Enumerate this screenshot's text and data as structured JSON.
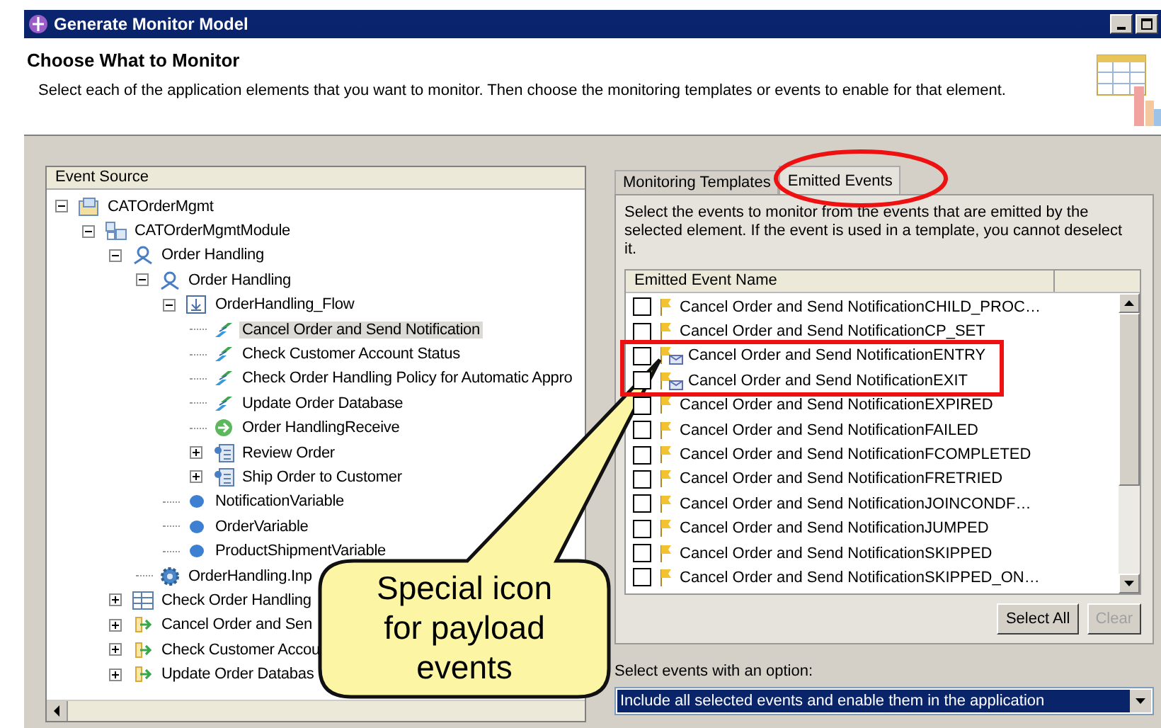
{
  "window": {
    "title": "Generate Monitor Model"
  },
  "header": {
    "title": "Choose What to Monitor",
    "description": "Select each of the application elements that you want to monitor. Then choose the monitoring templates or events to enable for that element."
  },
  "tree": {
    "column": "Event Source",
    "items": [
      {
        "label": "CATOrderMgmt",
        "kind": "project",
        "expanded": true,
        "selected": false,
        "children": [
          {
            "label": "CATOrderMgmtModule",
            "kind": "module",
            "expanded": true,
            "selected": false,
            "children": [
              {
                "label": "Order Handling",
                "kind": "process",
                "expanded": true,
                "selected": false,
                "children": [
                  {
                    "label": "Order Handling",
                    "kind": "process",
                    "expanded": true,
                    "selected": false,
                    "children": [
                      {
                        "label": "OrderHandling_Flow",
                        "kind": "flow",
                        "expanded": true,
                        "selected": false,
                        "children": [
                          {
                            "label": "Cancel Order and Send Notification",
                            "kind": "invoke",
                            "selected": true
                          },
                          {
                            "label": "Check Customer Account Status",
                            "kind": "invoke",
                            "selected": false
                          },
                          {
                            "label": "Check Order Handling Policy for Automatic Appro",
                            "kind": "invoke",
                            "selected": false
                          },
                          {
                            "label": "Update Order Database",
                            "kind": "invoke",
                            "selected": false
                          },
                          {
                            "label": "Order HandlingReceive",
                            "kind": "receive",
                            "selected": false
                          },
                          {
                            "label": "Review Order",
                            "kind": "task",
                            "expanded": false,
                            "selected": false
                          },
                          {
                            "label": "Ship Order to Customer",
                            "kind": "task",
                            "expanded": false,
                            "selected": false
                          }
                        ]
                      },
                      {
                        "label": "NotificationVariable",
                        "kind": "variable",
                        "selected": false
                      },
                      {
                        "label": "OrderVariable",
                        "kind": "variable",
                        "selected": false
                      },
                      {
                        "label": "ProductShipmentVariable",
                        "kind": "variable",
                        "selected": false
                      }
                    ]
                  },
                  {
                    "label": "OrderHandling.Inp",
                    "kind": "interface",
                    "selected": false
                  }
                ]
              },
              {
                "label": "Check Order Handling",
                "kind": "table",
                "expanded": false,
                "selected": false
              },
              {
                "label": "Cancel Order and Sen",
                "kind": "export",
                "expanded": false,
                "selected": false
              },
              {
                "label": "Check Customer Accou",
                "kind": "export",
                "expanded": false,
                "selected": false
              },
              {
                "label": "Update Order Databas",
                "kind": "export",
                "expanded": false,
                "selected": false
              }
            ]
          }
        ]
      }
    ]
  },
  "tabs": [
    {
      "label": "Monitoring Templates",
      "selected": false
    },
    {
      "label": "Emitted Events",
      "selected": true
    }
  ],
  "events_panel": {
    "instructions": "Select the events to monitor from the events that are emitted by the selected element. If the event is used in a template, you cannot deselect it.",
    "column": "Emitted Event Name",
    "events": [
      {
        "name": "Cancel Order and Send NotificationCHILD_PROC…",
        "kind": "standard",
        "checked": false
      },
      {
        "name": "Cancel Order and Send NotificationCP_SET",
        "kind": "standard",
        "checked": false
      },
      {
        "name": "Cancel Order and Send NotificationENTRY",
        "kind": "payload",
        "checked": false
      },
      {
        "name": "Cancel Order and Send NotificationEXIT",
        "kind": "payload",
        "checked": false
      },
      {
        "name": "Cancel Order and Send NotificationEXPIRED",
        "kind": "standard",
        "checked": false
      },
      {
        "name": "Cancel Order and Send NotificationFAILED",
        "kind": "standard",
        "checked": false
      },
      {
        "name": "Cancel Order and Send NotificationFCOMPLETED",
        "kind": "standard",
        "checked": false
      },
      {
        "name": "Cancel Order and Send NotificationFRETRIED",
        "kind": "standard",
        "checked": false
      },
      {
        "name": "Cancel Order and Send NotificationJOINCONDF…",
        "kind": "standard",
        "checked": false
      },
      {
        "name": "Cancel Order and Send NotificationJUMPED",
        "kind": "standard",
        "checked": false
      },
      {
        "name": "Cancel Order and Send NotificationSKIPPED",
        "kind": "standard",
        "checked": false
      },
      {
        "name": "Cancel Order and Send NotificationSKIPPED_ON…",
        "kind": "standard",
        "checked": false
      }
    ],
    "buttons": [
      {
        "label": "Select All",
        "disabled": false
      },
      {
        "label": "Clear",
        "disabled": true
      }
    ],
    "option_label": "Select events with an option:",
    "dropdown": {
      "value": "Include all selected events and enable them in the application"
    }
  },
  "annotations": {
    "callout": "Special icon for payload events"
  }
}
